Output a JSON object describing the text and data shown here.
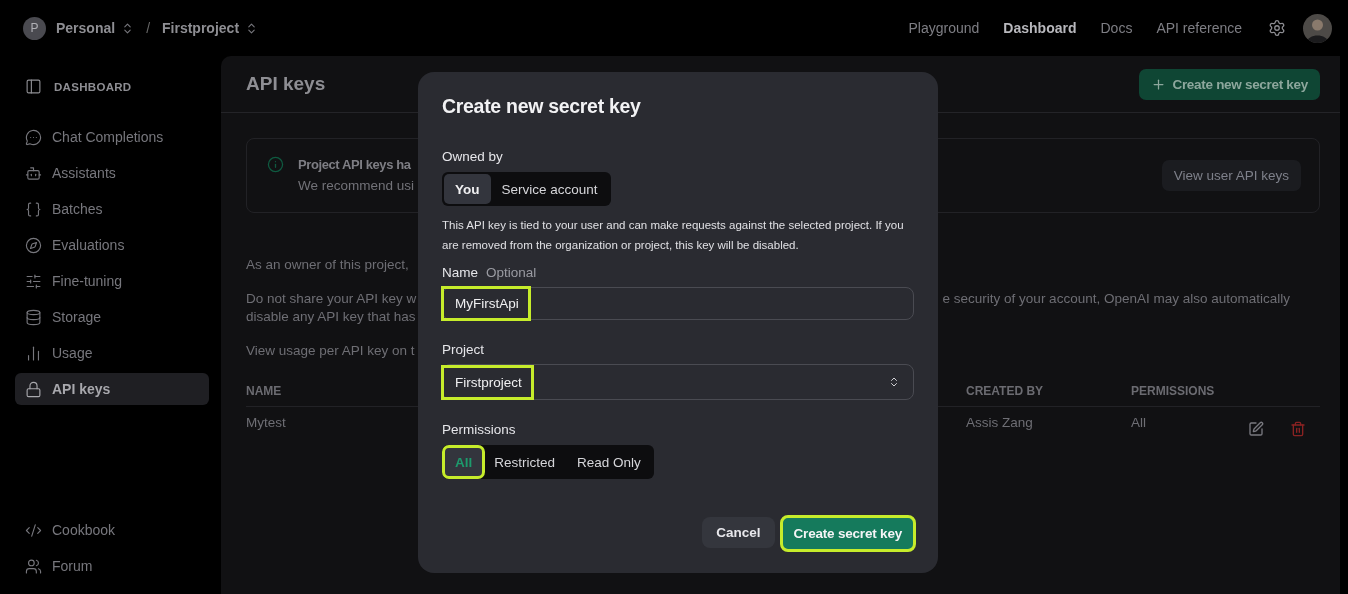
{
  "topbar": {
    "org": {
      "initial": "P",
      "name": "Personal"
    },
    "separator": "/",
    "project": "Firstproject",
    "nav": [
      {
        "label": "Playground",
        "selected": false
      },
      {
        "label": "Dashboard",
        "selected": true
      },
      {
        "label": "Docs",
        "selected": false
      },
      {
        "label": "API reference",
        "selected": false
      }
    ]
  },
  "sidebar": {
    "heading": "DASHBOARD",
    "items": [
      {
        "label": "Chat Completions",
        "kind": "chat",
        "selected": false
      },
      {
        "label": "Assistants",
        "kind": "bot",
        "selected": false
      },
      {
        "label": "Batches",
        "kind": "braces",
        "selected": false
      },
      {
        "label": "Evaluations",
        "kind": "compass",
        "selected": false
      },
      {
        "label": "Fine-tuning",
        "kind": "sliders",
        "selected": false
      },
      {
        "label": "Storage",
        "kind": "database",
        "selected": false
      },
      {
        "label": "Usage",
        "kind": "chart",
        "selected": false
      },
      {
        "label": "API keys",
        "kind": "lock",
        "selected": true
      }
    ],
    "footer": [
      {
        "label": "Cookbook",
        "kind": "code"
      },
      {
        "label": "Forum",
        "kind": "people"
      }
    ]
  },
  "main": {
    "title": "API keys",
    "create_button": "Create new secret key",
    "notice": {
      "title": "Project API keys ha",
      "body": "We recommend usi",
      "button": "View user API keys"
    },
    "paragraphs": [
      {
        "lines": [
          {
            "left": "As an owner of this project,"
          }
        ]
      },
      {
        "lines": [
          {
            "left": "Do not share your API key w",
            "right": "e security of your account, OpenAI may also automatically"
          },
          {
            "left": "disable any API key that has"
          }
        ]
      },
      {
        "lines": [
          {
            "left": "View usage per API key on t"
          }
        ]
      }
    ],
    "table": {
      "columns": [
        "NAME",
        "CREATED BY",
        "PERMISSIONS"
      ],
      "rows": [
        {
          "cells": [
            "Mytest",
            "Assis Zang",
            "All"
          ]
        }
      ]
    }
  },
  "dialog": {
    "title": "Create new secret key",
    "owned_label": "Owned by",
    "owners": [
      {
        "label": "You",
        "selected": true
      },
      {
        "label": "Service account",
        "selected": false
      }
    ],
    "description": "This API key is tied to your user and can make requests against the selected project. If you are removed from the organization or project, this key will be disabled.",
    "name_label": "Name",
    "name_hint": "Optional",
    "name_field": {
      "value": "MyFirstApi",
      "highlighted": true
    },
    "project_label": "Project",
    "project_select": {
      "value": "Firstproject",
      "highlighted": true
    },
    "permissions_label": "Permissions",
    "permissions": [
      {
        "label": "All",
        "selected": true,
        "highlighted": true
      },
      {
        "label": "Restricted",
        "selected": false,
        "highlighted": false
      },
      {
        "label": "Read Only",
        "selected": false,
        "highlighted": false
      }
    ],
    "cancel": "Cancel",
    "submit": {
      "label": "Create secret key",
      "highlighted": true
    }
  }
}
